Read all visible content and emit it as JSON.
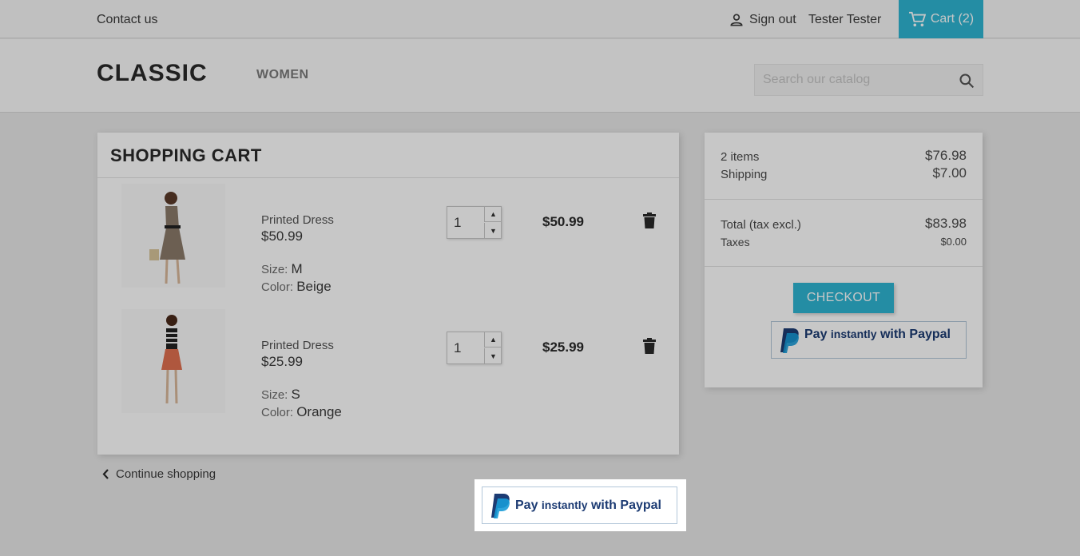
{
  "topbar": {
    "contact_label": "Contact us",
    "signout_label": "Sign out",
    "user_name": "Tester Tester",
    "cart_label": "Cart (2)"
  },
  "header": {
    "logo": "CLASSIC",
    "nav": [
      "WOMEN"
    ],
    "search_placeholder": "Search our catalog"
  },
  "cart": {
    "title": "SHOPPING CART",
    "items": [
      {
        "name": "Printed Dress",
        "unit_price": "$50.99",
        "size_label": "Size:",
        "size": "M",
        "color_label": "Color:",
        "color": "Beige",
        "quantity": "1",
        "total": "$50.99"
      },
      {
        "name": "Printed Dress",
        "unit_price": "$25.99",
        "size_label": "Size:",
        "size": "S",
        "color_label": "Color:",
        "color": "Orange",
        "quantity": "1",
        "total": "$25.99"
      }
    ],
    "continue_label": "Continue shopping"
  },
  "summary": {
    "items_label": "2 items",
    "items_value": "$76.98",
    "shipping_label": "Shipping",
    "shipping_value": "$7.00",
    "total_label": "Total (tax excl.)",
    "total_value": "$83.98",
    "taxes_label": "Taxes",
    "taxes_value": "$0.00",
    "checkout_label": "CHECKOUT"
  },
  "paypal": {
    "word_pay": "Pay",
    "word_instantly": "instantly",
    "word_with": "with Paypal"
  },
  "colors": {
    "accent": "#2fb5d2",
    "paypal_dark": "#1c3b73",
    "paypal_light": "#179bd7"
  }
}
